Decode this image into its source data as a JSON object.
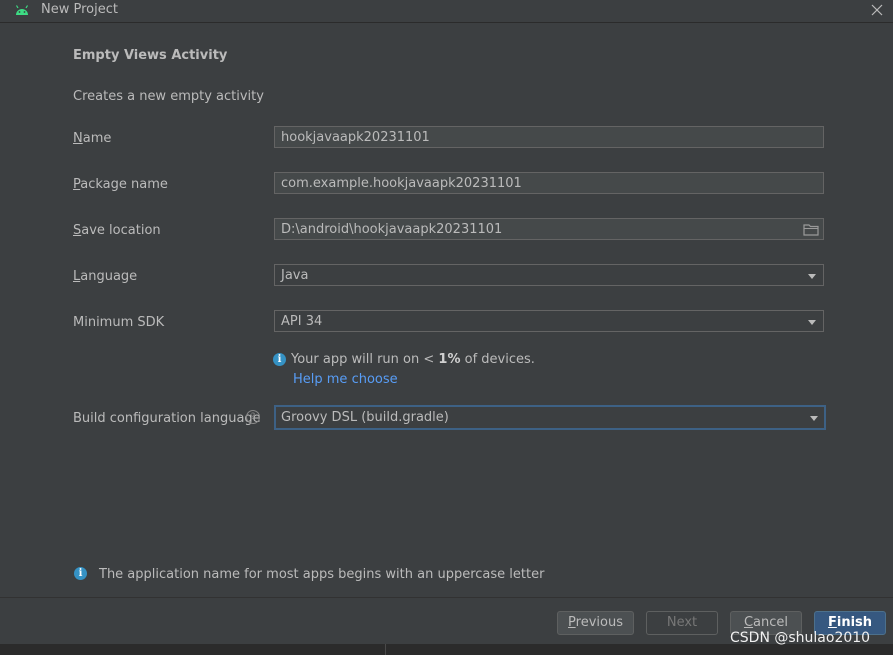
{
  "window": {
    "title": "New Project",
    "app_icon": "android-icon",
    "close_icon": "close-icon"
  },
  "header": {
    "title": "Empty Views Activity",
    "description": "Creates a new empty activity"
  },
  "form": {
    "name": {
      "label_mnemonic": "N",
      "label_rest": "ame",
      "value": "hookjavaapk20231101"
    },
    "package": {
      "label_mnemonic": "P",
      "label_rest": "ackage name",
      "value": "com.example.hookjavaapk20231101"
    },
    "save_location": {
      "label_mnemonic": "S",
      "label_rest": "ave location",
      "value": "D:\\android\\hookjavaapk20231101",
      "icon": "folder-icon"
    },
    "language": {
      "label_mnemonic": "L",
      "label_rest": "anguage",
      "value": "Java"
    },
    "min_sdk": {
      "label": "Minimum SDK",
      "value": "API 34"
    },
    "build_lang": {
      "label": "Build configuration language",
      "value": "Groovy DSL (build.gradle)",
      "help_icon": "?"
    }
  },
  "sdk_info": {
    "icon": "i",
    "text_prefix": "Your app will run on < ",
    "percent": "1%",
    "text_suffix": " of devices.",
    "help_link": "Help me choose"
  },
  "hint": {
    "icon": "i",
    "text": "The application name for most apps begins with an uppercase letter"
  },
  "buttons": {
    "previous": {
      "mnemonic": "P",
      "rest": "revious"
    },
    "next": "Next",
    "cancel": {
      "mnemonic": "C",
      "rest": "ancel"
    },
    "finish": {
      "mnemonic": "F",
      "rest": "inish"
    }
  },
  "watermark": "CSDN @shulao2010",
  "colors": {
    "background": "#3c3f41",
    "field_bg": "#45494a",
    "accent": "#365880",
    "link": "#589df6",
    "info": "#3592c4"
  }
}
